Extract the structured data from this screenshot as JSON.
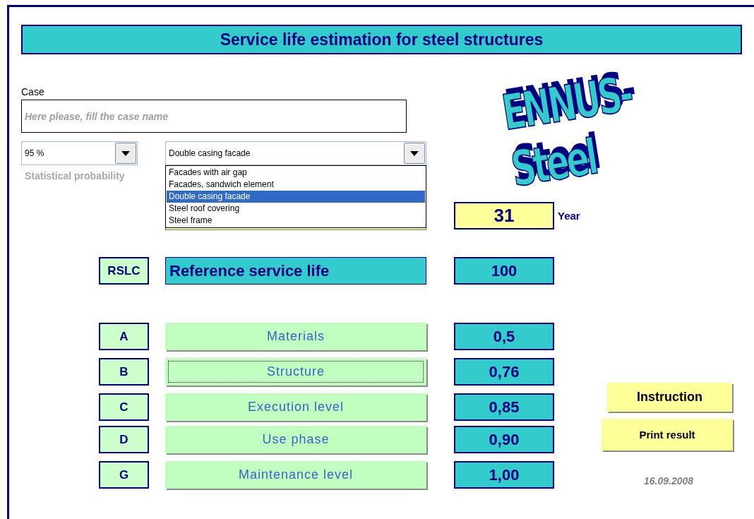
{
  "title": "Service life estimation for steel structures",
  "case": {
    "label": "Case",
    "placeholder": "Here please, fill the case name"
  },
  "probability": {
    "value": "95 %",
    "caption": "Statistical probability"
  },
  "facade": {
    "value": "Double casing facade",
    "expanded": true,
    "options": [
      {
        "label": "Facades with air gap",
        "selected": false
      },
      {
        "label": "Facades, sandwich element",
        "selected": false
      },
      {
        "label": "Double casing facade",
        "selected": true
      },
      {
        "label": "Steel roof covering",
        "selected": false
      },
      {
        "label": "Steel frame",
        "selected": false
      }
    ]
  },
  "logo": "ENNUS-Steel",
  "result": {
    "value": "31",
    "unit": "Year"
  },
  "reference": {
    "code": "RSLC",
    "label": "Reference service life",
    "value": "100"
  },
  "factors": [
    {
      "code": "A",
      "label": "Materials",
      "value": "0,5",
      "focused": false
    },
    {
      "code": "B",
      "label": "Structure",
      "value": "0,76",
      "focused": true
    },
    {
      "code": "C",
      "label": "Execution level",
      "value": "0,85",
      "focused": false
    },
    {
      "code": "D",
      "label": "Use phase",
      "value": "0,90",
      "focused": false
    },
    {
      "code": "G",
      "label": "Maintenance level",
      "value": "1,00",
      "focused": false
    }
  ],
  "buttons": [
    "Instruction",
    "Print result"
  ],
  "date": "16.09.2008"
}
